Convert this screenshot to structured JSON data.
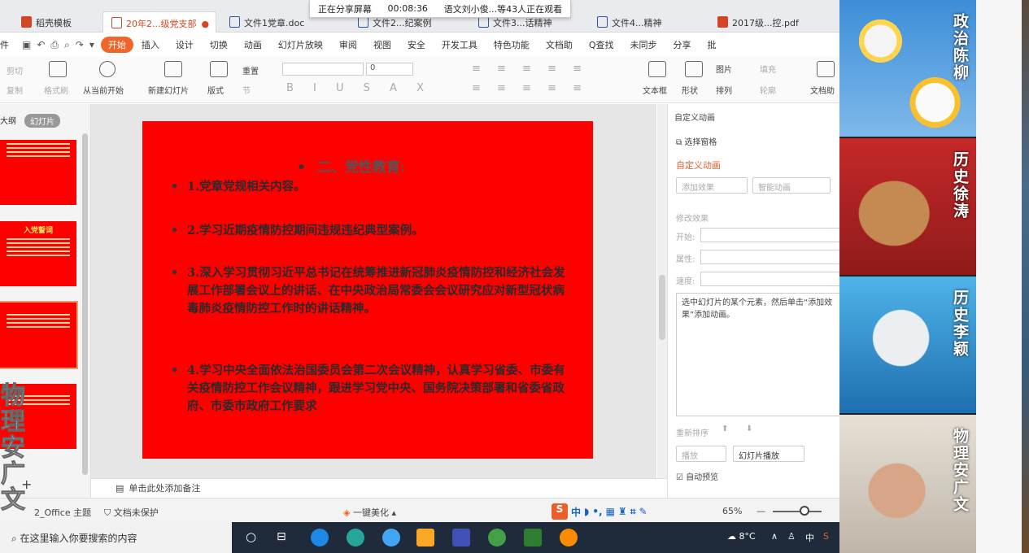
{
  "share": {
    "status": "正在分享屏幕",
    "time": "00:08:36",
    "viewers": "语文刘小俊...等43人正在观看"
  },
  "tabs": [
    {
      "label": "稻壳模板",
      "color": "#d24625"
    },
    {
      "label": "20年2...级党支部",
      "color": "#d24625",
      "active": true
    },
    {
      "label": "文件1党章.doc",
      "color": "#2b579a"
    },
    {
      "label": "文件2...纪案例",
      "color": "#2b579a"
    },
    {
      "label": "文件3...话精神",
      "color": "#2b579a"
    },
    {
      "label": "文件4...精神",
      "color": "#2b579a"
    },
    {
      "label": "2017级...控.pdf",
      "color": "#d24625"
    }
  ],
  "menu": {
    "file": "件",
    "items": [
      "开始",
      "插入",
      "设计",
      "切换",
      "动画",
      "幻灯片放映",
      "审阅",
      "视图",
      "安全",
      "开发工具",
      "特色功能",
      "文档助"
    ],
    "search": "Q查找",
    "sync": "未同步",
    "share": "分享",
    "review": "批"
  },
  "ribbon": {
    "cut": "剪切",
    "copy": "复制",
    "painter": "格式刷",
    "play_from_current": "从当前开始",
    "new_slide": "新建幻灯片",
    "layout": "版式",
    "reset": "重置",
    "section": "节",
    "font_size": "0",
    "textbox": "文本框",
    "shape": "形状",
    "picture": "图片",
    "fill": "填充",
    "arrange": "排列",
    "outline": "轮廓",
    "doc_assist": "文档助"
  },
  "left_panel": {
    "outline_tab": "大纲",
    "slides_tab": "幻灯片",
    "thumb2_title": "入党誓词"
  },
  "slide": {
    "title": "二、党性教育:",
    "bullets": [
      "1.党章党规相关内容。",
      "2.学习近期疫情防控期间违规违纪典型案例。",
      "3.深入学习贯彻习近平总书记在统筹推进新冠肺炎疫情防控和经济社会发展工作部署会议上的讲话、在中央政治局常委会会议研究应对新型冠状病毒肺炎疫情防控工作时的讲话精神。",
      "4.学习中央全面依法治国委员会第二次会议精神，认真学习省委、市委有关疫情防控工作会议精神，跟进学习党中央、国务院决策部署和省委省政府、市委市政府工作要求"
    ]
  },
  "notes_placeholder": "单击此处添加备注",
  "right_pane": {
    "header": "自定义动画",
    "select_pane": "选择窗格",
    "section_title": "自定义动画",
    "add_effect": "添加效果",
    "smart_anim": "智能动画",
    "modify_effect": "修改效果",
    "start_label": "开始:",
    "property_label": "属性:",
    "speed_label": "速度:",
    "hint": "选中幻灯片的某个元素，然后单击“添加效果”添加动画。",
    "reorder": "重新排序",
    "play": "播放",
    "slideshow": "幻灯片播放",
    "auto_preview": "自动预览"
  },
  "status": {
    "theme": "2_Office 主题",
    "protect": "文档未保护",
    "beautify": "一键美化",
    "ime": "中",
    "zoom": "65%"
  },
  "taskbar": {
    "search": "在这里输入你要搜索的内容",
    "weather": "8°C",
    "lang": "中"
  },
  "video": {
    "tiles": [
      {
        "name": "政治陈柳"
      },
      {
        "name": "历史徐涛"
      },
      {
        "name": "历史李颖"
      },
      {
        "name": "物理安广文"
      }
    ]
  },
  "watermark": "物理安广文",
  "colors": {
    "accent": "#f0652a",
    "slide_bg": "#ff0000"
  }
}
